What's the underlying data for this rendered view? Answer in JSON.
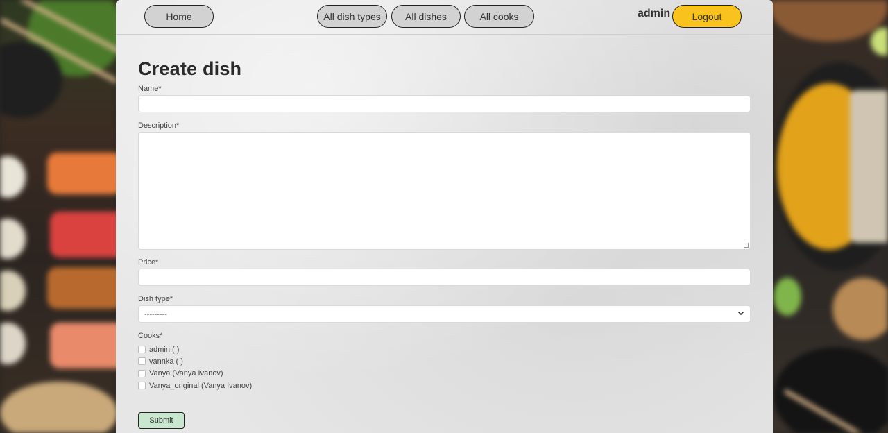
{
  "nav": {
    "home": "Home",
    "dish_types": "All dish types",
    "dishes": "All dishes",
    "cooks": "All cooks",
    "username": "admin",
    "logout": "Logout"
  },
  "form": {
    "title": "Create dish",
    "name_label": "Name*",
    "name_value": "",
    "description_label": "Description*",
    "description_value": "",
    "price_label": "Price*",
    "price_value": "",
    "dish_type_label": "Dish type*",
    "dish_type_selected": "---------",
    "cooks_label": "Cooks*",
    "cooks": [
      {
        "label": "admin ( )",
        "checked": false
      },
      {
        "label": "vannka ( )",
        "checked": false
      },
      {
        "label": "Vanya (Vanya Ivanov)",
        "checked": false
      },
      {
        "label": "Vanya_original (Vanya Ivanov)",
        "checked": false
      }
    ],
    "submit_label": "Submit"
  },
  "colors": {
    "logout_bg": "#f9c21c",
    "pill_bg": "#d2d2d2",
    "submit_bg": "#c9e7cf"
  }
}
